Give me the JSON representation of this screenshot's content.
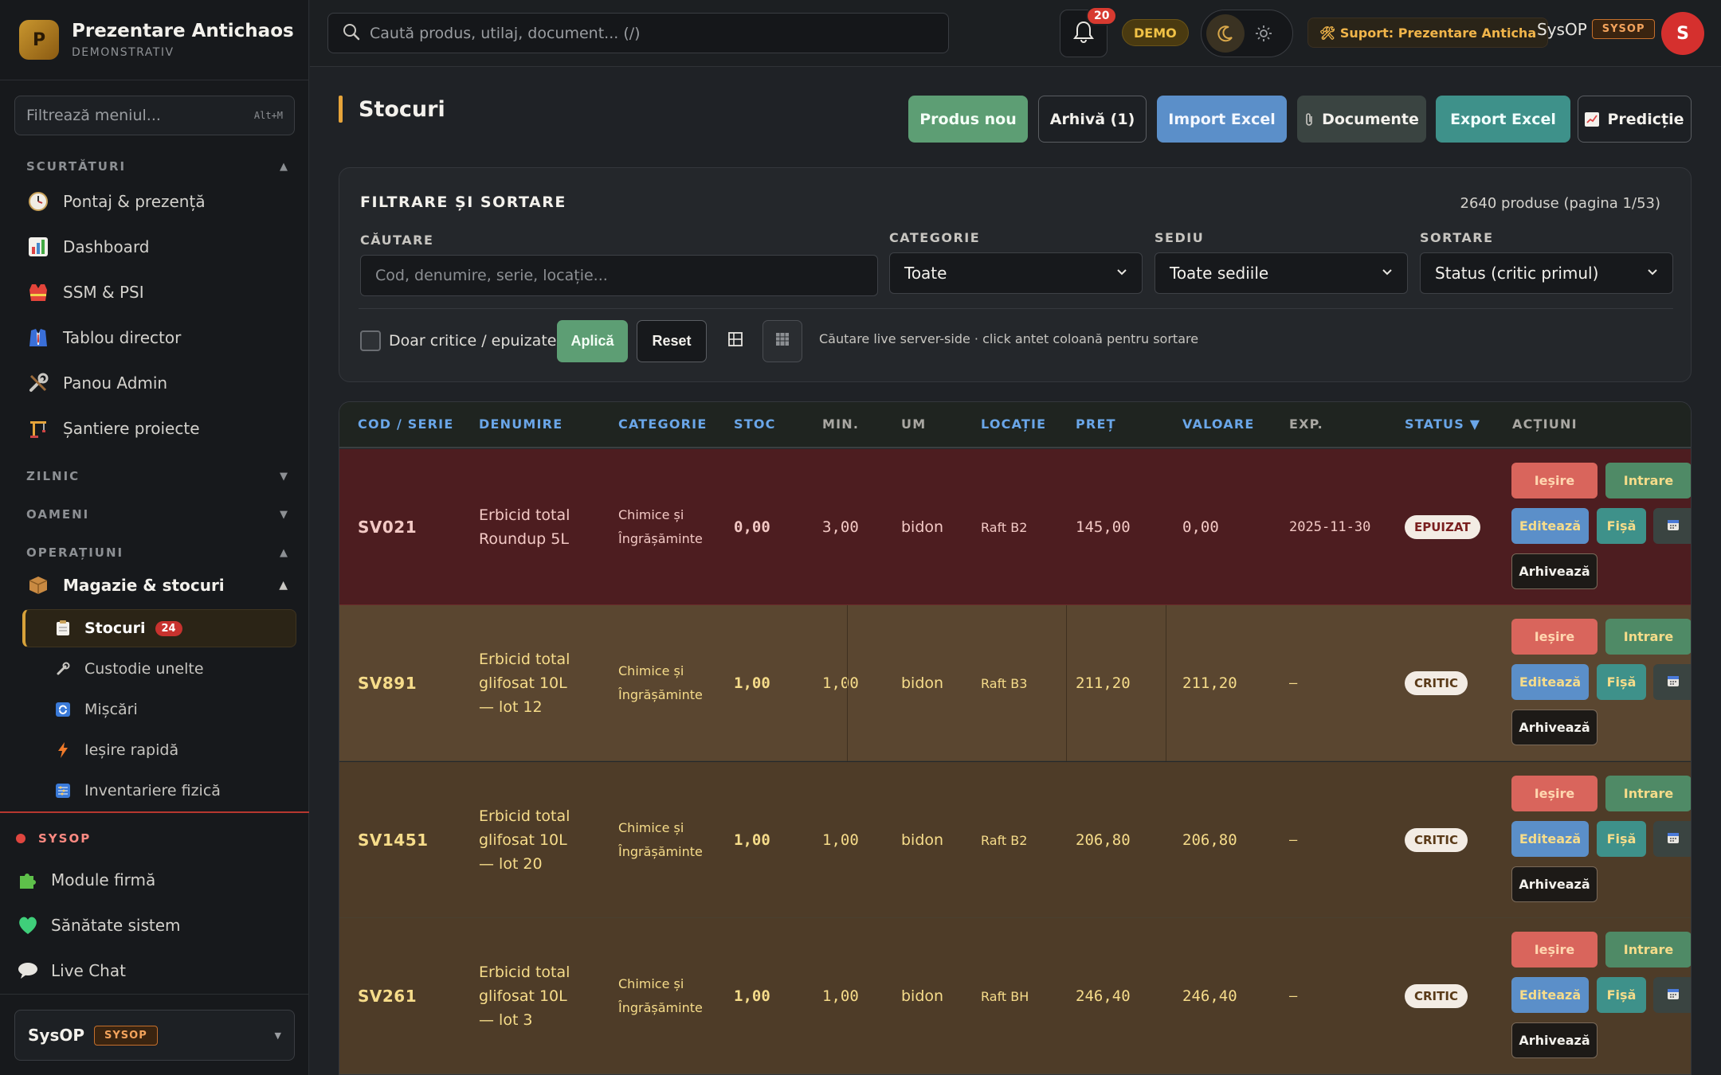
{
  "brand": {
    "logo_letter": "P",
    "title": "Prezentare Antichaos",
    "subtitle": "DEMONSTRATIV"
  },
  "menu_filter": {
    "placeholder": "Filtrează meniul...",
    "shortcut": "Alt+M"
  },
  "sidebar": {
    "shortcuts_label": "SCURTĂTURI",
    "shortcuts": [
      {
        "label": "Pontaj & prezență",
        "icon": "clock-icon"
      },
      {
        "label": "Dashboard",
        "icon": "chart-icon"
      },
      {
        "label": "SSM & PSI",
        "icon": "vest-icon"
      },
      {
        "label": "Tablou director",
        "icon": "suit-icon"
      },
      {
        "label": "Panou Admin",
        "icon": "tools-icon"
      },
      {
        "label": "Șantiere proiecte",
        "icon": "crane-icon"
      }
    ],
    "zilnic_label": "ZILNIC",
    "oameni_label": "OAMENI",
    "operatiuni_label": "OPERAȚIUNI",
    "group": {
      "label": "Magazie & stocuri",
      "icon": "box-icon"
    },
    "subitems": [
      {
        "label": "Stocuri",
        "icon": "clipboard-icon",
        "badge": "24",
        "active": true
      },
      {
        "label": "Custodie unelte",
        "icon": "wrench-icon"
      },
      {
        "label": "Mișcări",
        "icon": "refresh-icon"
      },
      {
        "label": "Ieșire rapidă",
        "icon": "lightning-icon"
      },
      {
        "label": "Inventariere fizică",
        "icon": "abacus-icon"
      }
    ],
    "sysop_label": "SYSOP",
    "sysop_items": [
      {
        "label": "Module firmă",
        "icon": "puzzle-icon"
      },
      {
        "label": "Sănătate sistem",
        "icon": "heart-icon"
      },
      {
        "label": "Live Chat",
        "icon": "chat-icon"
      }
    ],
    "user": {
      "name": "SysOP",
      "role": "SYSOP"
    }
  },
  "topbar": {
    "search_placeholder": "Caută produs, utilaj, document... (/)",
    "notifications_count": "20",
    "demo_label": "DEMO",
    "support_label": "🛠 Suport: Prezentare Anticha",
    "user_name": "SysOP",
    "user_role": "SYSOP",
    "avatar_letter": "S"
  },
  "page": {
    "title": "Stocuri",
    "buttons": {
      "new_product": "Produs nou",
      "archive": "Arhivă (1)",
      "import": "Import Excel",
      "documents": "Documente",
      "export": "Export Excel",
      "prediction": "Predicție"
    }
  },
  "filters": {
    "title": "FILTRARE ȘI SORTARE",
    "count": "2640 produse (pagina 1/53)",
    "search_label": "CĂUTARE",
    "search_placeholder": "Cod, denumire, serie, locație...",
    "category_label": "CATEGORIE",
    "category_value": "Toate",
    "site_label": "SEDIU",
    "site_value": "Toate sediile",
    "sort_label": "SORTARE",
    "sort_value": "Status (critic primul)",
    "critical_only": "Doar critice / epuizate",
    "apply": "Aplică",
    "reset": "Reset",
    "hint": "Căutare live server-side · click antet coloană pentru sortare"
  },
  "table": {
    "headers": [
      "COD / SERIE",
      "DENUMIRE",
      "CATEGORIE",
      "STOC",
      "MIN.",
      "UM",
      "LOCAȚIE",
      "PREȚ",
      "VALOARE",
      "EXP.",
      "STATUS ▼",
      "ACȚIUNI"
    ],
    "actions": {
      "out": "Ieșire",
      "in": "Intrare",
      "edit": "Editează",
      "sheet": "Fișă",
      "archive": "Arhivează"
    },
    "rows": [
      {
        "code": "SV021",
        "name": "Erbicid total Roundup 5L",
        "category": "Chimice și Îngrășăminte",
        "stock": "0,00",
        "min": "3,00",
        "um": "bidon",
        "location": "Raft B2",
        "price": "145,00",
        "value": "0,00",
        "exp": "2025-11-30",
        "status": "EPUIZAT"
      },
      {
        "code": "SV891",
        "name": "Erbicid total glifosat 10L — lot 12",
        "category": "Chimice și Îngrășăminte",
        "stock": "1,00",
        "min": "1,00",
        "um": "bidon",
        "location": "Raft B3",
        "price": "211,20",
        "value": "211,20",
        "exp": "—",
        "status": "CRITIC"
      },
      {
        "code": "SV1451",
        "name": "Erbicid total glifosat 10L — lot 20",
        "category": "Chimice și Îngrășăminte",
        "stock": "1,00",
        "min": "1,00",
        "um": "bidon",
        "location": "Raft B2",
        "price": "206,80",
        "value": "206,80",
        "exp": "—",
        "status": "CRITIC"
      },
      {
        "code": "SV261",
        "name": "Erbicid total glifosat 10L — lot 3",
        "category": "Chimice și Îngrășăminte",
        "stock": "1,00",
        "min": "1,00",
        "um": "bidon",
        "location": "Raft BH",
        "price": "246,40",
        "value": "246,40",
        "exp": "—",
        "status": "CRITIC"
      }
    ]
  },
  "colors": {
    "accent": "#e6a43a",
    "header_text": "#6aa6e8",
    "depleted_row": "#4d1d20",
    "critical_row": "#4e3c28"
  }
}
